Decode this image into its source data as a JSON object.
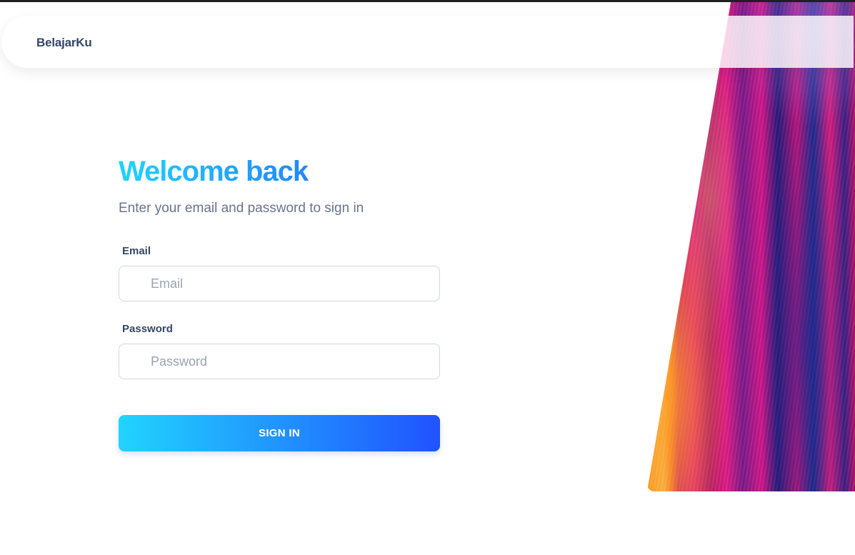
{
  "brand": {
    "name": "BelajarKu"
  },
  "login": {
    "title": "Welcome back",
    "subtitle": "Enter your email and password to sign in",
    "email_label": "Email",
    "email_placeholder": "Email",
    "email_value": "",
    "password_label": "Password",
    "password_placeholder": "Password",
    "password_value": "",
    "submit_label": "SIGN IN"
  },
  "colors": {
    "accent_start": "#21d4fd",
    "accent_end": "#2152ff",
    "text_dark": "#344767",
    "text_muted": "#67748e"
  }
}
